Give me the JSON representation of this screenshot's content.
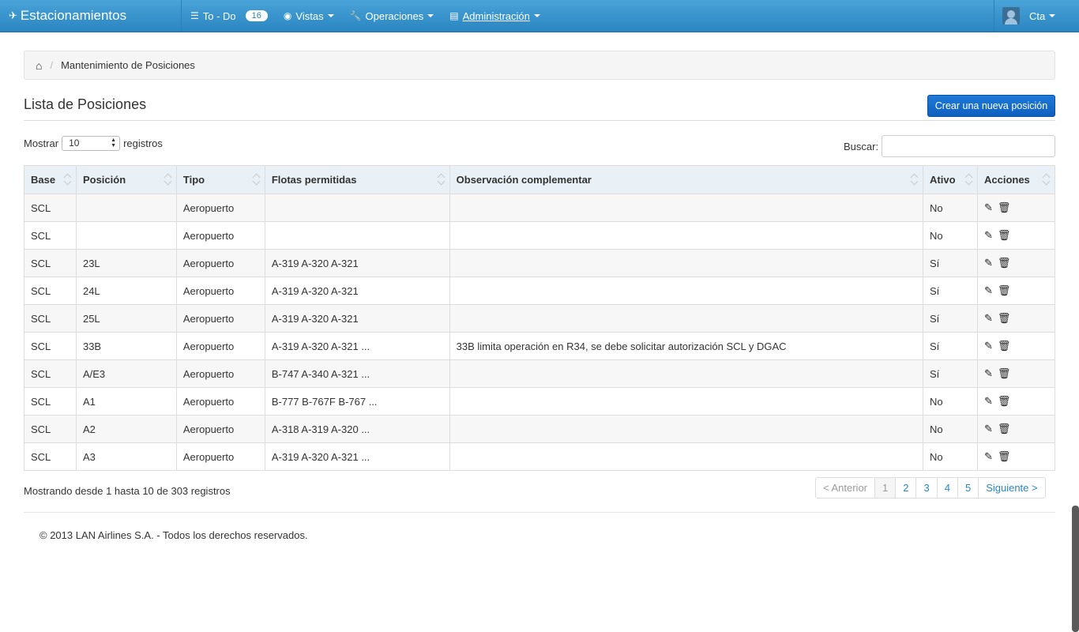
{
  "navbar": {
    "brand": "Estacionamientos",
    "todo_label": "To - Do",
    "todo_count": "16",
    "vistas_label": "Vistas",
    "operaciones_label": "Operaciones",
    "administracion_label": "Administración",
    "user_label": "Cta"
  },
  "breadcrumb": {
    "current": "Mantenimiento de Posiciones"
  },
  "page": {
    "title": "Lista de Posiciones",
    "create_button": "Crear una nueva posición"
  },
  "controls": {
    "show_label": "Mostrar",
    "page_size": "10",
    "records_label": "registros",
    "search_label": "Buscar:"
  },
  "table": {
    "headers": [
      "Base",
      "Posición",
      "Tipo",
      "Flotas permitidas",
      "Observación complementar",
      "Ativo",
      "Acciones"
    ],
    "rows": [
      [
        "SCL",
        "",
        "Aeropuerto",
        "",
        "",
        "No"
      ],
      [
        "SCL",
        "",
        "Aeropuerto",
        "",
        "",
        "No"
      ],
      [
        "SCL",
        "23L",
        "Aeropuerto",
        "A-319 A-320 A-321",
        "",
        "Sí"
      ],
      [
        "SCL",
        "24L",
        "Aeropuerto",
        "A-319 A-320 A-321",
        "",
        "Sí"
      ],
      [
        "SCL",
        "25L",
        "Aeropuerto",
        "A-319 A-320 A-321",
        "",
        "Sí"
      ],
      [
        "SCL",
        "33B",
        "Aeropuerto",
        "A-319 A-320 A-321 ...",
        "33B limita operación en R34, se debe solicitar autorización SCL y DGAC",
        "Sí"
      ],
      [
        "SCL",
        "A/E3",
        "Aeropuerto",
        "B-747 A-340 A-321 ...",
        "",
        "Sí"
      ],
      [
        "SCL",
        "A1",
        "Aeropuerto",
        "B-777 B-767F B-767 ...",
        "",
        "No"
      ],
      [
        "SCL",
        "A2",
        "Aeropuerto",
        "A-318 A-319 A-320 ...",
        "",
        "No"
      ],
      [
        "SCL",
        "A3",
        "Aeropuerto",
        "A-319 A-320 A-321 ...",
        "",
        "No"
      ]
    ]
  },
  "info": "Mostrando desde 1 hasta 10 de 303 registros",
  "pagination": {
    "prev": "< Anterior",
    "pages": [
      "1",
      "2",
      "3",
      "4",
      "5"
    ],
    "next": "Siguiente >"
  },
  "footer": "© 2013 LAN Airlines S.A. - Todos los derechos reservados.",
  "icons": {
    "brand": "plane-icon",
    "todo": "list-icon",
    "vistas": "eye-icon",
    "operaciones": "wrench-icon",
    "administracion": "calendar-icon",
    "home": "home-icon",
    "edit": "pencil-icon",
    "delete": "trash-icon"
  }
}
